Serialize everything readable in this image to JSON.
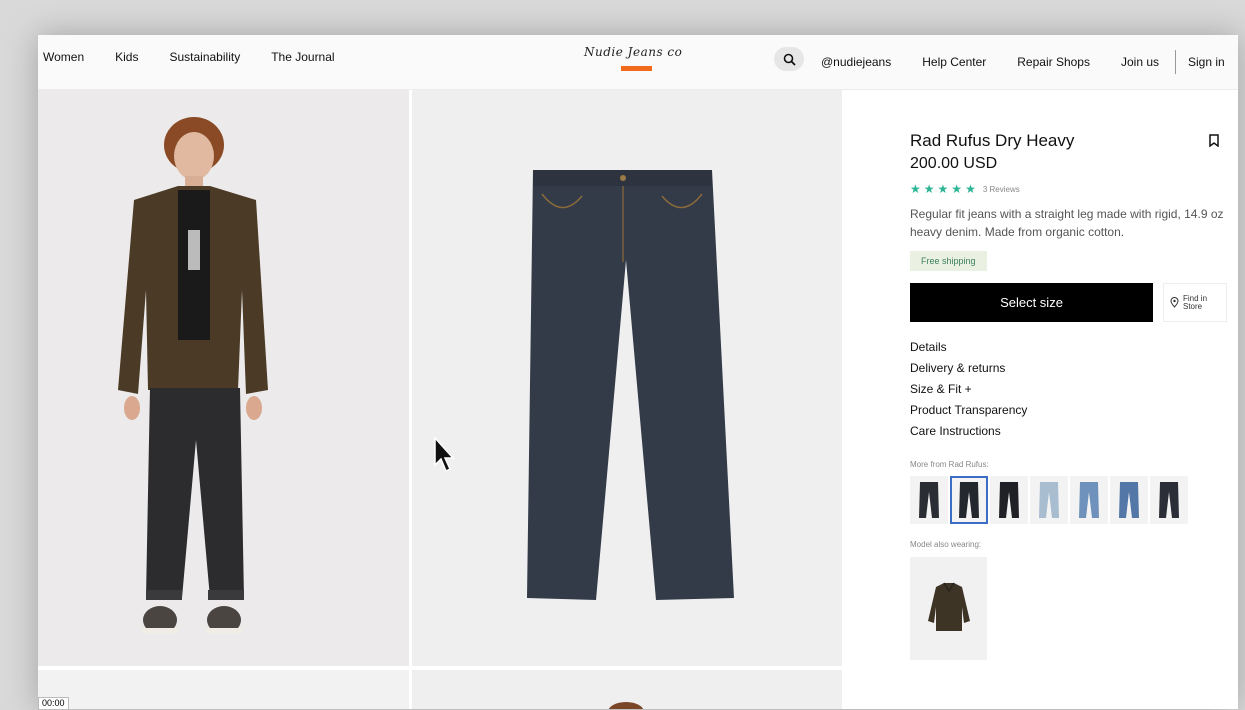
{
  "nav": {
    "left_items": [
      "Women",
      "Kids",
      "Sustainability",
      "The Journal"
    ],
    "logo_text": "Nudie Jeans co",
    "right_items": [
      "@nudiejeans",
      "Help Center",
      "Repair Shops",
      "Join us"
    ],
    "sign_in": "Sign in"
  },
  "product": {
    "title": "Rad Rufus Dry Heavy",
    "price": "200.00 USD",
    "rating": 5,
    "reviews": "3 Reviews",
    "description": "Regular fit jeans with a straight leg made with rigid, 14.9 oz heavy denim. Made from organic cotton.",
    "shipping_badge": "Free shipping",
    "select_size": "Select size",
    "find_in_store": "Find in Store",
    "accordions": [
      "Details",
      "Delivery & returns",
      "Size & Fit +",
      "Product Transparency",
      "Care Instructions"
    ],
    "more_from_label": "More from Rad Rufus:",
    "variant_colors": [
      "#2a2d33",
      "#23272e",
      "#1f2127",
      "#a8bdd0",
      "#6e92bb",
      "#5377a6",
      "#2b2e36"
    ],
    "active_variant": 1,
    "model_wearing_label": "Model also wearing:"
  },
  "colors": {
    "accent": "#f26b1d",
    "star": "#2bb594",
    "button": "#000000"
  },
  "video": {
    "timestamp": "00:00"
  }
}
